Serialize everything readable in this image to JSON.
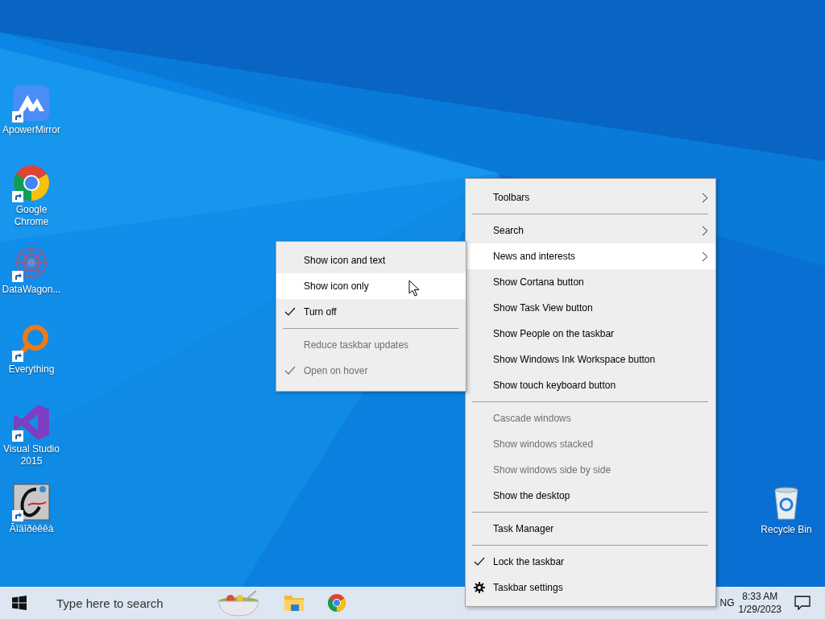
{
  "desktop_icons": [
    {
      "label": "ApowerMirror",
      "shortcut": true
    },
    {
      "label": "Google\nChrome",
      "shortcut": true
    },
    {
      "label": "DataWagon...",
      "shortcut": true
    },
    {
      "label": "Everything",
      "shortcut": true
    },
    {
      "label": "Visual Studio\n2015",
      "shortcut": true
    },
    {
      "label": "Ãîäîðèêêà",
      "shortcut": true
    }
  ],
  "recycle_bin": {
    "label": "Recycle Bin",
    "shortcut": false
  },
  "context_menu": {
    "items": [
      {
        "kind": "item",
        "label": "Toolbars",
        "submenu": true,
        "selected": false,
        "checked": false,
        "disabled": false
      },
      {
        "kind": "separator"
      },
      {
        "kind": "item",
        "label": "Search",
        "submenu": true,
        "selected": false,
        "checked": false,
        "disabled": false
      },
      {
        "kind": "item",
        "label": "News and interests",
        "submenu": true,
        "selected": true,
        "checked": false,
        "disabled": false
      },
      {
        "kind": "item",
        "label": "Show Cortana button",
        "submenu": false,
        "selected": false,
        "checked": false,
        "disabled": false
      },
      {
        "kind": "item",
        "label": "Show Task View button",
        "submenu": false,
        "selected": false,
        "checked": false,
        "disabled": false
      },
      {
        "kind": "item",
        "label": "Show People on the taskbar",
        "submenu": false,
        "selected": false,
        "checked": false,
        "disabled": false
      },
      {
        "kind": "item",
        "label": "Show Windows Ink Workspace button",
        "submenu": false,
        "selected": false,
        "checked": false,
        "disabled": false
      },
      {
        "kind": "item",
        "label": "Show touch keyboard button",
        "submenu": false,
        "selected": false,
        "checked": false,
        "disabled": false
      },
      {
        "kind": "separator"
      },
      {
        "kind": "item",
        "label": "Cascade windows",
        "submenu": false,
        "selected": false,
        "checked": false,
        "disabled": true
      },
      {
        "kind": "item",
        "label": "Show windows stacked",
        "submenu": false,
        "selected": false,
        "checked": false,
        "disabled": true
      },
      {
        "kind": "item",
        "label": "Show windows side by side",
        "submenu": false,
        "selected": false,
        "checked": false,
        "disabled": true
      },
      {
        "kind": "item",
        "label": "Show the desktop",
        "submenu": false,
        "selected": false,
        "checked": false,
        "disabled": false
      },
      {
        "kind": "separator"
      },
      {
        "kind": "item",
        "label": "Task Manager",
        "submenu": false,
        "selected": false,
        "checked": false,
        "disabled": false
      },
      {
        "kind": "separator"
      },
      {
        "kind": "item",
        "label": "Lock the taskbar",
        "submenu": false,
        "selected": false,
        "checked": true,
        "disabled": false
      },
      {
        "kind": "settings",
        "label": "Taskbar settings",
        "submenu": false,
        "selected": false,
        "checked": false,
        "disabled": false
      }
    ]
  },
  "submenu": {
    "items": [
      {
        "kind": "item",
        "label": "Show icon and text",
        "submenu": false,
        "selected": false,
        "checked": false,
        "disabled": false
      },
      {
        "kind": "item",
        "label": "Show icon only",
        "submenu": false,
        "selected": true,
        "checked": false,
        "disabled": false
      },
      {
        "kind": "item",
        "label": "Turn off",
        "submenu": false,
        "selected": false,
        "checked": true,
        "disabled": false
      },
      {
        "kind": "separator"
      },
      {
        "kind": "item",
        "label": "Reduce taskbar updates",
        "submenu": false,
        "selected": false,
        "checked": false,
        "disabled": true
      },
      {
        "kind": "item",
        "label": "Open on hover",
        "submenu": false,
        "selected": false,
        "checked": true,
        "disabled": true
      }
    ]
  },
  "taskbar": {
    "search": {
      "placeholder": "Type here to search"
    },
    "language": "NG",
    "time": "8:33 AM",
    "date": "1/29/2023"
  }
}
